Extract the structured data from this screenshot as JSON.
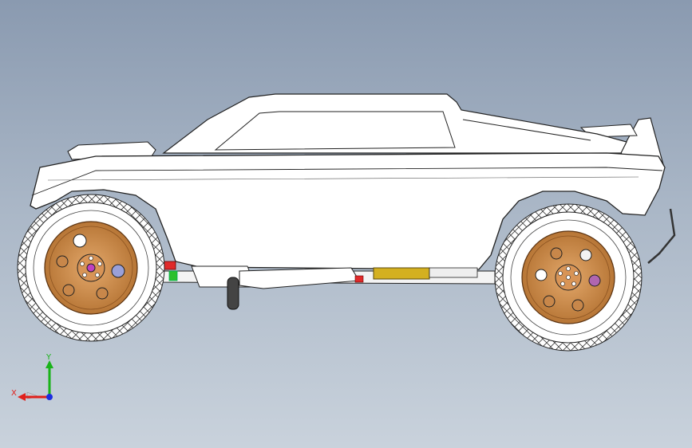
{
  "triad": {
    "x_label": "X",
    "y_label": "Y",
    "x_color": "#e0201c",
    "y_color": "#19b319",
    "z_color": "#1c2ee0"
  },
  "colors": {
    "background_top": "#8a9ab0",
    "background_bottom": "#c9d2dc",
    "body": "#ffffff",
    "rim": "#c8874a",
    "tire": "#ffffff",
    "battery": "#d4b020"
  }
}
